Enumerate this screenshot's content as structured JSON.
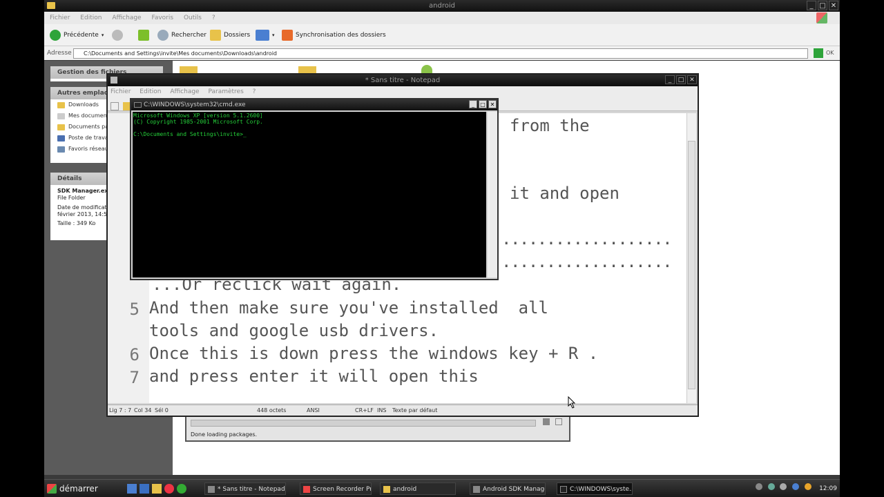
{
  "explorer": {
    "title": "android",
    "menu": [
      "Fichier",
      "Edition",
      "Affichage",
      "Favoris",
      "Outils",
      "?"
    ],
    "toolbar": {
      "back": "Précédente",
      "search": "Rechercher",
      "folders": "Dossiers",
      "sync": "Synchronisation des dossiers"
    },
    "address_label": "Adresse",
    "address": "C:\\Documents and Settings\\invite\\Mes documents\\Downloads\\android",
    "go": "OK",
    "left": {
      "tasks_header": "Gestion des fichiers",
      "other_header": "Autres emplacements",
      "other_items": [
        "Downloads",
        "Mes documents",
        "Documents partagés",
        "Poste de travail",
        "Favoris réseau"
      ],
      "details_header": "Détails",
      "details_name": "SDK Manager.exe",
      "details_type": "File Folder",
      "details_date_label": "Date de modification :",
      "details_date": "février 2013, 14:5",
      "details_size": "Taille : 349 Ko"
    }
  },
  "sdk_manager": {
    "status": "Done loading packages."
  },
  "notepad": {
    "title": "* Sans titre - Notepad",
    "menu": [
      "Fichier",
      "Edition",
      "Affichage",
      "Paramètres",
      "?"
    ],
    "fragments": {
      "line_a": "from the",
      "line_b": "it and open",
      "dots_a": "...................",
      "dots_b": "...................",
      "line_c": "...Or reclick wait again."
    },
    "lines": [
      {
        "num": "5",
        "text": "And then make sure you've installed  all"
      },
      {
        "num": "",
        "text": "tools and google usb drivers."
      },
      {
        "num": "6",
        "text": "Once this is down press the windows key + R ."
      },
      {
        "num": "7",
        "text": "and press enter it will open this"
      }
    ],
    "status": {
      "position": "Lig 7 : 7",
      "col": "Col 34",
      "sel": "Sél 0",
      "size": "448 octets",
      "encoding": "ANSI",
      "eol": "CR+LF",
      "ins": "INS",
      "style": "Texte par défaut"
    }
  },
  "cmd": {
    "title": "C:\\WINDOWS\\system32\\cmd.exe",
    "lines": [
      "Microsoft Windows XP [version 5.1.2600]",
      "(C) Copyright 1985-2001 Microsoft Corp.",
      "",
      "C:\\Documents and Settings\\invite>_"
    ]
  },
  "taskbar": {
    "start": "démarrer",
    "tasks": [
      "* Sans titre - Notepad",
      "Screen Recorder Pr...",
      "android",
      "Android SDK Manager",
      "C:\\WINDOWS\\syste..."
    ],
    "clock": "12:09"
  }
}
